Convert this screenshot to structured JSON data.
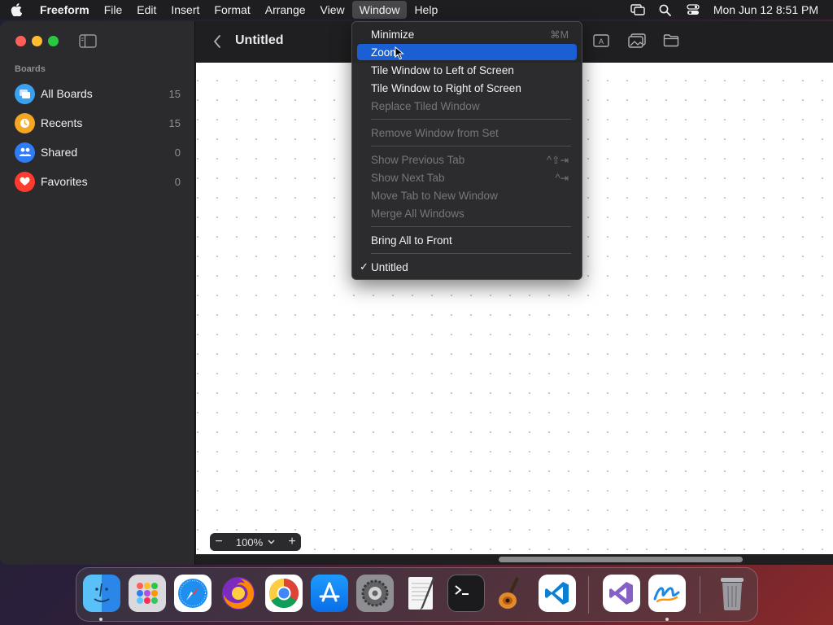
{
  "menubar": {
    "app_name": "Freeform",
    "items": [
      "File",
      "Edit",
      "Insert",
      "Format",
      "Arrange",
      "View",
      "Window",
      "Help"
    ],
    "active_item": "Window",
    "clock": "Mon Jun 12  8:51 PM"
  },
  "sidebar": {
    "heading": "Boards",
    "items": [
      {
        "label": "All Boards",
        "count": "15",
        "icon": "all-boards-icon",
        "color": "#3aa0f0"
      },
      {
        "label": "Recents",
        "count": "15",
        "icon": "clock-icon",
        "color": "#f5a623"
      },
      {
        "label": "Shared",
        "count": "0",
        "icon": "people-icon",
        "color": "#2f7cf6"
      },
      {
        "label": "Favorites",
        "count": "0",
        "icon": "heart-icon",
        "color": "#ff3b30"
      }
    ]
  },
  "toolbar": {
    "title": "Untitled"
  },
  "zoom": {
    "value": "100%",
    "minus": "−",
    "plus": "+"
  },
  "window_menu": {
    "items": [
      {
        "label": "Minimize",
        "shortcut": "⌘M",
        "disabled": false
      },
      {
        "label": "Zoom",
        "shortcut": "",
        "disabled": false,
        "highlight": true
      },
      {
        "label": "Tile Window to Left of Screen",
        "shortcut": "",
        "disabled": false
      },
      {
        "label": "Tile Window to Right of Screen",
        "shortcut": "",
        "disabled": false
      },
      {
        "label": "Replace Tiled Window",
        "shortcut": "",
        "disabled": true
      },
      {
        "label": "Remove Window from Set",
        "shortcut": "",
        "disabled": true
      },
      {
        "label": "Show Previous Tab",
        "shortcut": "^⇧⇥",
        "disabled": true
      },
      {
        "label": "Show Next Tab",
        "shortcut": "^⇥",
        "disabled": true
      },
      {
        "label": "Move Tab to New Window",
        "shortcut": "",
        "disabled": true
      },
      {
        "label": "Merge All Windows",
        "shortcut": "",
        "disabled": true
      },
      {
        "label": "Bring All to Front",
        "shortcut": "",
        "disabled": false
      },
      {
        "label": "Untitled",
        "shortcut": "",
        "disabled": false,
        "checked": true
      }
    ],
    "check_mark": "✓"
  },
  "dock": {
    "apps": [
      "Finder",
      "Launchpad",
      "Safari",
      "Firefox",
      "Chrome",
      "App Store",
      "System Settings",
      "TextEdit",
      "Terminal",
      "GarageBand",
      "Visual Studio Code",
      "Visual Studio",
      "Freeform",
      "Trash"
    ]
  },
  "colors": {
    "menu_highlight": "#1a5fd4",
    "traffic_close": "#ff5f57",
    "traffic_min": "#febc2e",
    "traffic_max": "#28c840"
  }
}
